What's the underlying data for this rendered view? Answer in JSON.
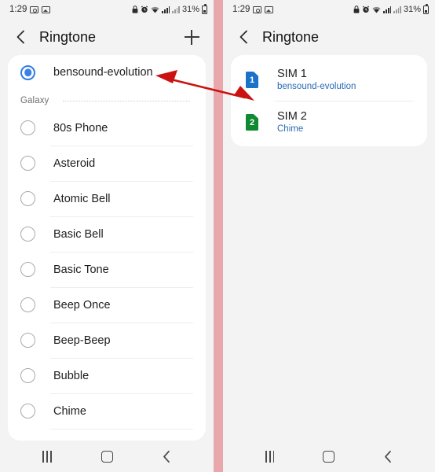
{
  "status_bar": {
    "time": "1:29",
    "left_icons": [
      "camera-icon",
      "photo-icon"
    ],
    "battery_percent": "31%",
    "right_icons": [
      "lock-icon",
      "alarm-icon",
      "wifi-icon",
      "signal-icon",
      "signal-secondary-icon",
      "battery-icon"
    ]
  },
  "left_screen": {
    "app_bar": {
      "back_label": "back-icon",
      "title": "Ringtone",
      "add_label": "add-icon"
    },
    "selected_ringtone": {
      "label": "bensound-evolution",
      "checked": true
    },
    "section": {
      "label": "Galaxy"
    },
    "ringtones": [
      {
        "label": "80s Phone",
        "checked": false
      },
      {
        "label": "Asteroid",
        "checked": false
      },
      {
        "label": "Atomic Bell",
        "checked": false
      },
      {
        "label": "Basic Bell",
        "checked": false
      },
      {
        "label": "Basic Tone",
        "checked": false
      },
      {
        "label": "Beep Once",
        "checked": false
      },
      {
        "label": "Beep-Beep",
        "checked": false
      },
      {
        "label": "Bubble",
        "checked": false
      },
      {
        "label": "Chime",
        "checked": false
      }
    ]
  },
  "right_screen": {
    "app_bar": {
      "back_label": "back-icon",
      "title": "Ringtone"
    },
    "sims": [
      {
        "number": "1",
        "title": "SIM 1",
        "subtitle": "bensound-evolution",
        "color": "#1a73c8"
      },
      {
        "number": "2",
        "title": "SIM 2",
        "subtitle": "Chime",
        "color": "#0f8a33"
      }
    ]
  },
  "nav_bar": {
    "recents_label": "recents-icon",
    "home_label": "home-icon",
    "back_label": "back-icon"
  },
  "annotation": {
    "arrow_color": "#cc1111",
    "description": "double-headed-arrow"
  },
  "colors": {
    "accent_blue": "#3b82e8",
    "divider_pink": "#e7a7ab",
    "sim1_blue": "#1a73c8",
    "sim2_green": "#0f8a33",
    "link_blue": "#2a6ab5"
  }
}
